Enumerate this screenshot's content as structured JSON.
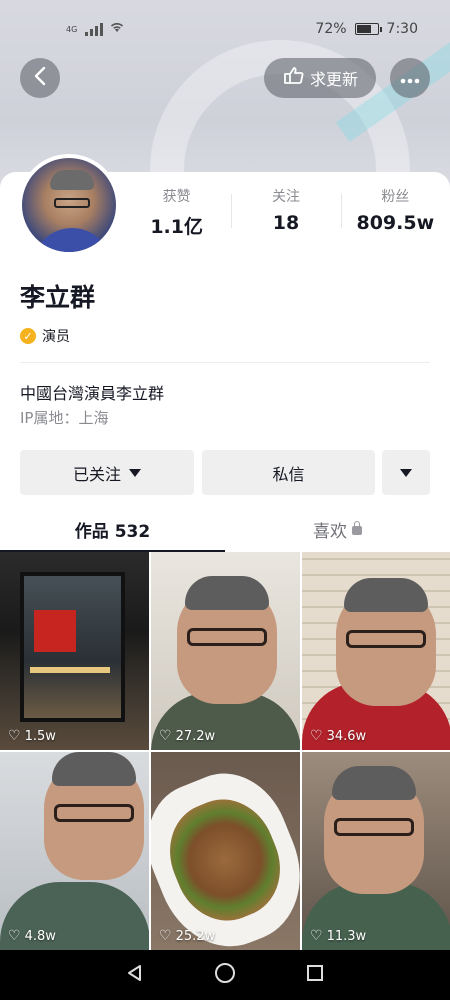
{
  "status_bar": {
    "network": "4G",
    "battery": "72%",
    "battery_level": 0.72,
    "time": "7:30"
  },
  "header": {
    "back_icon": "chevron-left-icon",
    "update_label": "求更新",
    "update_icon": "pointing-hand-icon",
    "more_icon": "more-dots-icon"
  },
  "profile": {
    "stats": [
      {
        "label": "获赞",
        "value": "1.1亿"
      },
      {
        "label": "关注",
        "value": "18"
      },
      {
        "label": "粉丝",
        "value": "809.5w"
      }
    ],
    "name": "李立群",
    "verify_badge": "✓",
    "verified_title": "演员",
    "bio": "中國台灣演員李立群",
    "ip_location": "IP属地：上海"
  },
  "actions": {
    "followed_label": "已关注",
    "message_label": "私信"
  },
  "tabs": [
    {
      "label": "作品 532"
    },
    {
      "label": "喜欢"
    }
  ],
  "videos": [
    {
      "likes": "1.5w"
    },
    {
      "likes": "27.2w"
    },
    {
      "likes": "34.6w"
    },
    {
      "likes": "4.8w"
    },
    {
      "likes": "25.2w"
    },
    {
      "likes": "11.3w"
    }
  ],
  "colors": {
    "text_primary": "#161823",
    "text_secondary": "#8a8b91",
    "verify_badge": "#f5b21e",
    "button_bg": "#efefef"
  }
}
